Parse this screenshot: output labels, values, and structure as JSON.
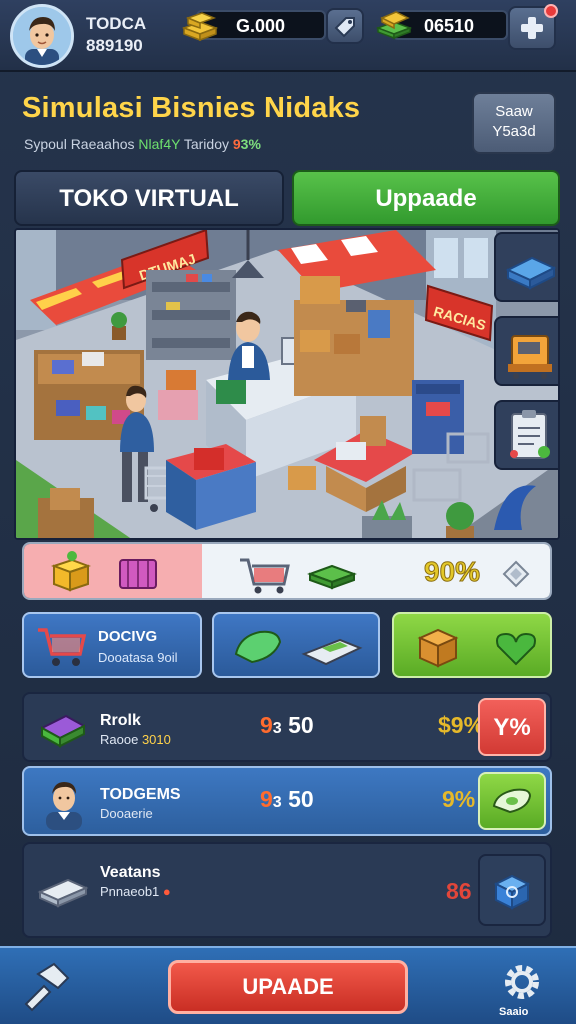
{
  "player": {
    "name": "TODCA",
    "id": "889190"
  },
  "currencies": [
    {
      "name": "cash",
      "value": "G.000",
      "icon": "gold-bars-icon"
    },
    {
      "name": "gems",
      "value": "06510",
      "icon": "money-stack-icon"
    }
  ],
  "header": {
    "title": "Simulasi Bisnies Nidaks",
    "subtitle_a": "Sypoul Raeaahos",
    "subtitle_b": "Nlaf4Y",
    "subtitle_c": "Taridoy",
    "subtitle_d": "9",
    "subtitle_e": "3%",
    "save_line1": "Saaw",
    "save_line2": "Y5a3d"
  },
  "tabs": {
    "store": "TOKO VIRTUAL",
    "upgrade": "Uppaade"
  },
  "scene": {
    "sign_left": "DTUMAJ",
    "sign_right": "RACIAS"
  },
  "progress": {
    "percent": "90%",
    "fill_fraction": 0.9
  },
  "categories": [
    {
      "label": "DOCIVG",
      "sub": "Dooatasa 9oil"
    }
  ],
  "rows": [
    {
      "title": "Rrolk",
      "sub_a": "Raooe",
      "sub_b": "3010",
      "cost_pin": "9",
      "cost_suffix": "3",
      "cost": "50",
      "pct": "$9%",
      "button": "Y%"
    },
    {
      "title": "TODGEMS",
      "sub": "Dooaerie",
      "cost_pin": "9",
      "cost_suffix": "3",
      "cost": "50",
      "pct": "9%"
    },
    {
      "title": "Veatans",
      "sub": "Pnnaeob1",
      "pct": "86"
    }
  ],
  "bottom": {
    "upgrade": "UPAADE",
    "settings": "Saaio"
  },
  "colors": {
    "gold": "#ffd54a",
    "green": "#4cb83e",
    "red": "#e2463a",
    "blue": "#3a72bc",
    "panel": "#2a3a55"
  }
}
